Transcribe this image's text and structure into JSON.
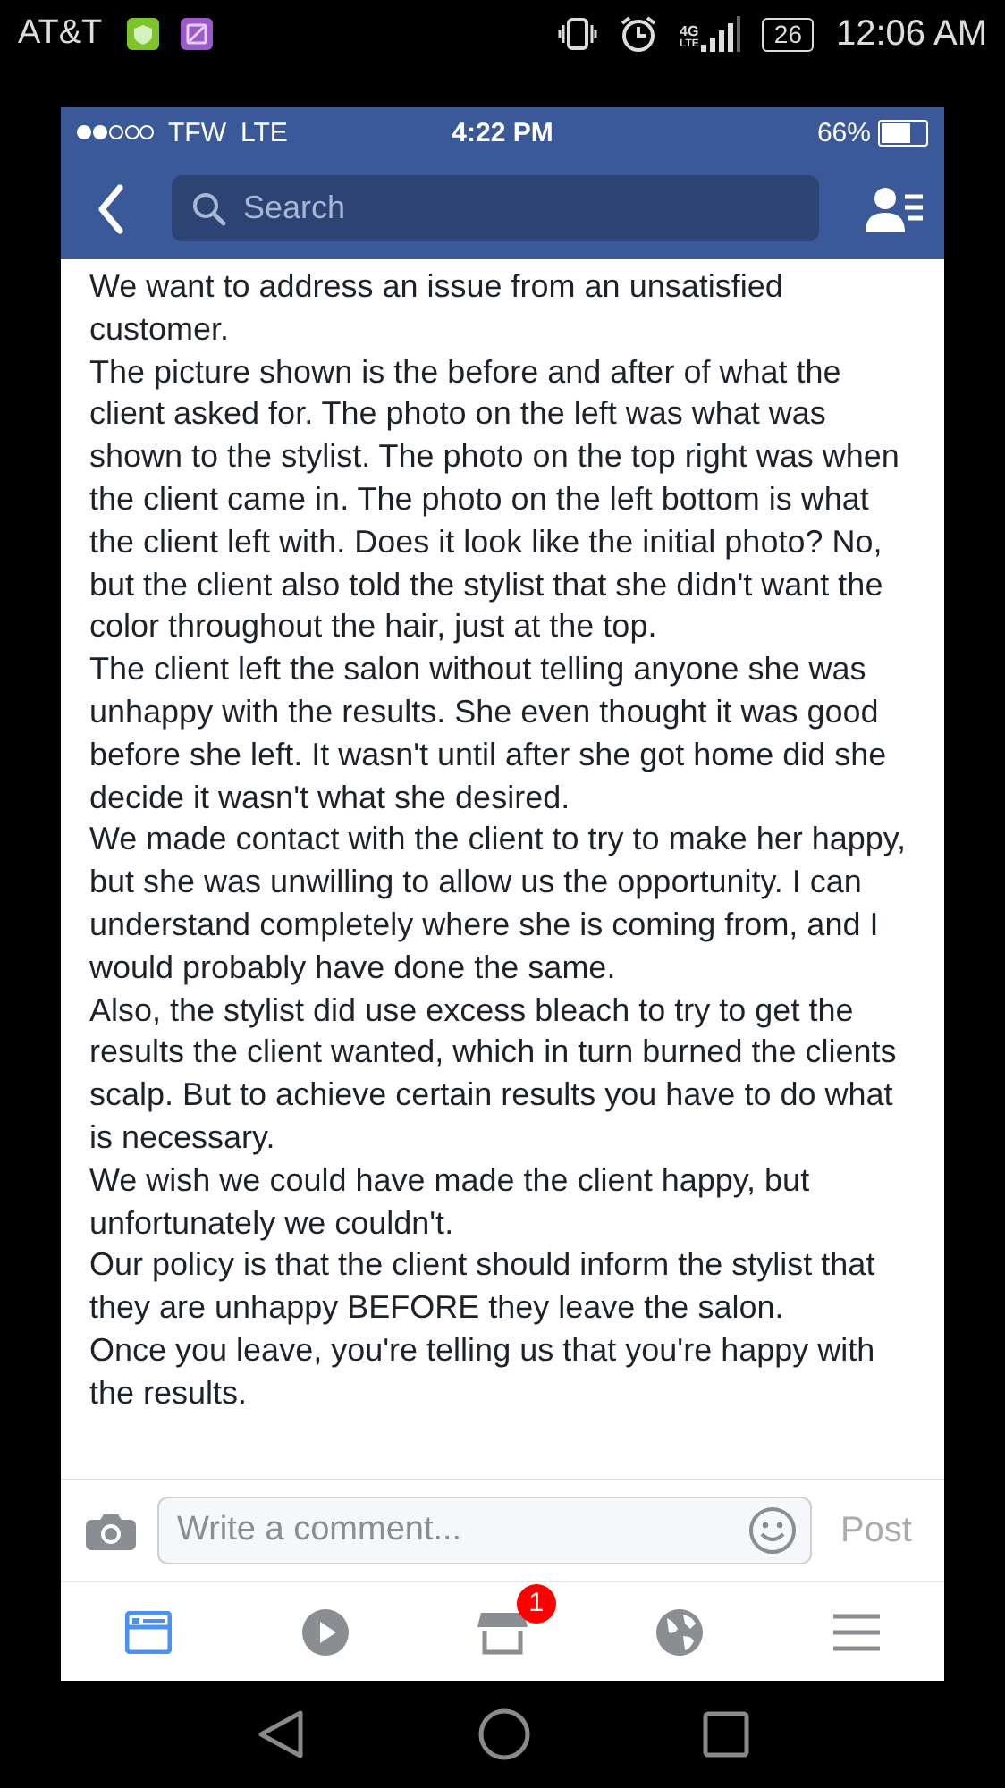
{
  "android_status_bar": {
    "carrier": "AT&T",
    "network_label": "4G",
    "network_sublabel": "LTE",
    "battery": "26",
    "time": "12:06 AM"
  },
  "ios_status_bar": {
    "carrier": "TFW",
    "network": "LTE",
    "time": "4:22 PM",
    "battery": "66%"
  },
  "nav_bar": {
    "search": {
      "placeholder": "Search"
    }
  },
  "post": {
    "paragraphs": [
      "We want to address an issue from an unsatisfied customer.",
      "The picture shown is the before and after of what the client asked for. The photo on the left was what was shown to the stylist. The photo on the top right was when the client came in. The photo on the left bottom is what the client left with. Does it look like the initial photo? No, but the client also told the stylist that she didn't want the color throughout the hair, just at the top.",
      "The client left the salon without telling anyone she was unhappy with the results. She even thought it was good before she left. It wasn't until after she got home did she decide it wasn't what she desired.",
      "We made contact with the client to try to make her happy, but she was unwilling to allow us the opportunity. I can understand completely where she is coming from, and I would probably have done the same.",
      "Also, the stylist did use excess bleach to try to get the results the client wanted, which in turn burned the clients scalp. But to achieve certain results you have to do what is necessary.",
      "We wish we could have made the client happy, but unfortunately we couldn't.",
      "Our policy is that the client should inform the stylist that they are unhappy BEFORE they leave the salon.",
      "Once you leave, you're telling us that you're happy with the results."
    ]
  },
  "comment_bar": {
    "placeholder": "Write a comment...",
    "post_button": "Post",
    "post_disabled": true
  },
  "tab_bar": [
    {
      "kind": "feed",
      "selected": true
    },
    {
      "kind": "video",
      "selected": false
    },
    {
      "kind": "marketplace",
      "selected": false,
      "badge": "1"
    },
    {
      "kind": "globe",
      "selected": false
    },
    {
      "kind": "menu",
      "selected": false
    }
  ]
}
